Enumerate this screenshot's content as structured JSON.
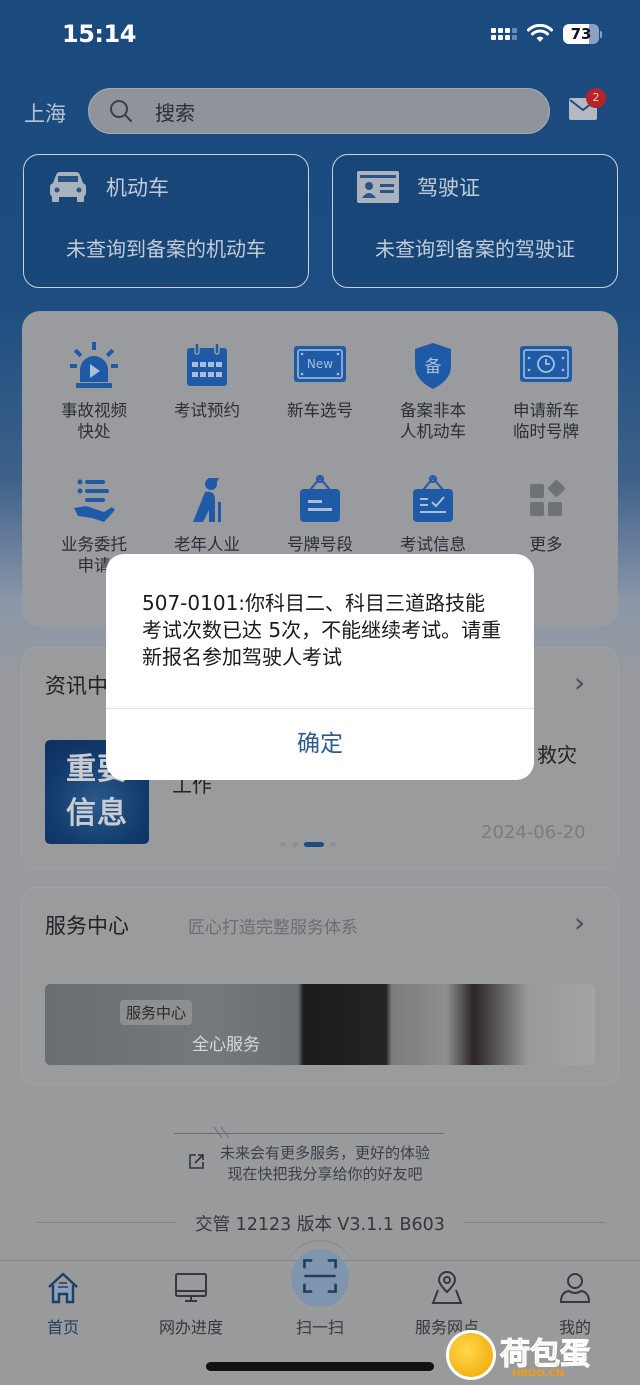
{
  "status_bar": {
    "time": "15:14",
    "battery": "73"
  },
  "header": {
    "city": "上海",
    "search_placeholder": "搜索",
    "mail_badge": "2"
  },
  "cards": [
    {
      "icon": "car-icon",
      "title": "机动车",
      "subtitle": "未查询到备案的机动车"
    },
    {
      "icon": "id-card-icon",
      "title": "驾驶证",
      "subtitle": "未查询到备案的驾驶证"
    }
  ],
  "services": [
    {
      "icon": "siren-video-icon",
      "line1": "事故视频",
      "line2": "快处"
    },
    {
      "icon": "calendar-icon",
      "line1": "考试预约",
      "line2": ""
    },
    {
      "icon": "new-plate-icon",
      "line1": "新车选号",
      "line2": "",
      "badge": "New"
    },
    {
      "icon": "shield-icon",
      "line1": "备案非本",
      "line2": "人机动车",
      "badge": "备"
    },
    {
      "icon": "temp-plate-icon",
      "line1": "申请新车",
      "line2": "临时号牌"
    },
    {
      "icon": "hand-list-icon",
      "line1": "业务委托",
      "line2": "申请"
    },
    {
      "icon": "elderly-icon",
      "line1": "老年人业",
      "line2": ""
    },
    {
      "icon": "plate-sign-icon",
      "line1": "号牌号段",
      "line2": ""
    },
    {
      "icon": "exam-sign-icon",
      "line1": "考试信息",
      "line2": ""
    },
    {
      "icon": "more-grid-icon",
      "line1": "更多",
      "line2": ""
    }
  ],
  "news": {
    "title": "资讯中心",
    "thumb_line1": "重要",
    "thumb_line2": "信息",
    "headline_visible_end": "救灾",
    "headline_line2": "工作",
    "date": "2024-06-20",
    "page_index": 3,
    "page_count": 4
  },
  "service_center": {
    "title": "服务中心",
    "subtitle": "匠心打造完整服务体系",
    "banner_tag": "服务中心",
    "banner_caption": "全心服务"
  },
  "footer": {
    "share_line1": "未来会有更多服务，更好的体验",
    "share_line2": "现在快把我分享给你的好友吧",
    "version": "交管 12123 版本 V3.1.1 B603"
  },
  "tabbar": [
    {
      "icon": "home-icon",
      "label": "首页",
      "active": true
    },
    {
      "icon": "monitor-icon",
      "label": "网办进度"
    },
    {
      "icon": "scan-icon",
      "label": "扫一扫"
    },
    {
      "icon": "map-pin-icon",
      "label": "服务网点"
    },
    {
      "icon": "user-icon",
      "label": "我的"
    }
  ],
  "dialog": {
    "message": "507-0101:你科目二、科目三道路技能考试次数已达 5次，不能继续考试。请重新报名参加驾驶人考试",
    "confirm_label": "确定"
  },
  "watermark": {
    "text": "荷包蛋",
    "url": "HBDO.CN"
  },
  "colors": {
    "primary_blue": "#1f5aa6",
    "dialog_button": "#2f5b8c",
    "badge_red": "#b8232a"
  }
}
